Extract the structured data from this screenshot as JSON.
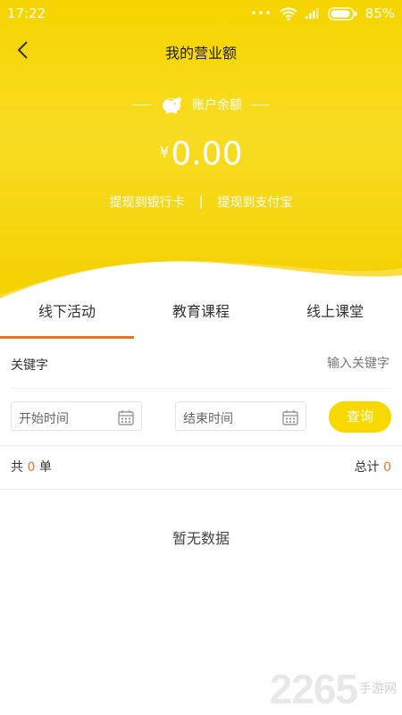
{
  "status": {
    "time": "17:22",
    "battery": "85%"
  },
  "nav": {
    "title": "我的营业额"
  },
  "balance": {
    "label": "账户余额",
    "currency": "¥",
    "amount": "0.00",
    "withdraw_bank": "提现到银行卡",
    "separator": "|",
    "withdraw_alipay": "提现到支付宝"
  },
  "tabs": [
    {
      "label": "线下活动",
      "active": true
    },
    {
      "label": "教育课程",
      "active": false
    },
    {
      "label": "线上课堂",
      "active": false
    }
  ],
  "filter": {
    "keyword_label": "关键字",
    "keyword_placeholder": "输入关键字",
    "start_placeholder": "开始时间",
    "end_placeholder": "结束时间",
    "query_label": "查询"
  },
  "summary": {
    "count_prefix": "共",
    "count": "0",
    "count_suffix": "单",
    "total_label": "总计",
    "total": "0"
  },
  "empty_text": "暂无数据",
  "watermark": {
    "number": "2265",
    "text": "手游网"
  },
  "colors": {
    "brand_yellow": "#f7d800",
    "accent_orange": "#e8751e"
  }
}
